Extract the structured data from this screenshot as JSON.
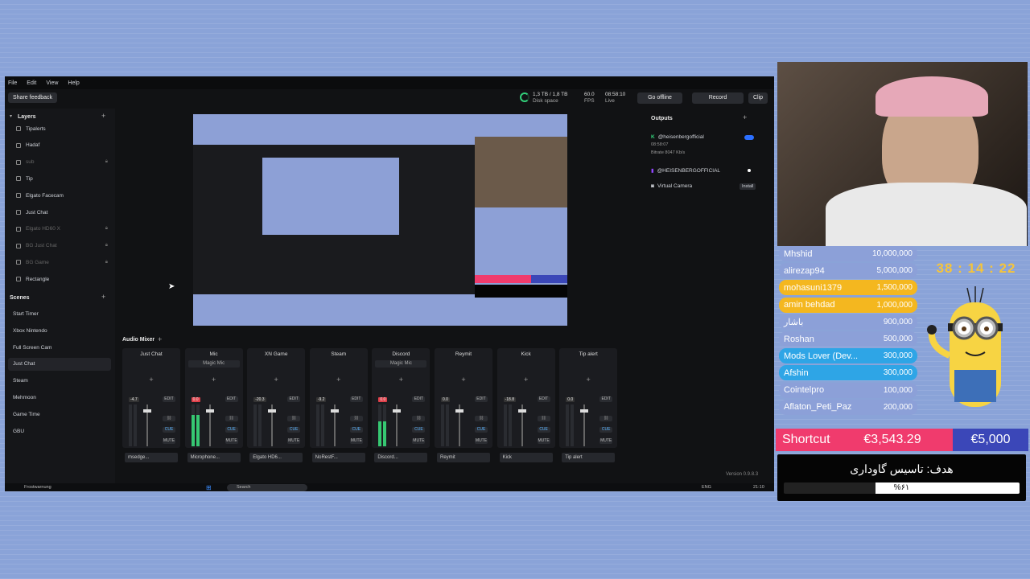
{
  "menu": [
    "File",
    "Edit",
    "View",
    "Help"
  ],
  "top": {
    "feedback": "Share feedback",
    "disk": "1,3 TB / 1,8 TB",
    "disk_label": "Disk space",
    "fps": "60.0",
    "fps_label": "FPS",
    "live_time": "08:58:10",
    "live_label": "Live",
    "go_offline": "Go offline",
    "record": "Record",
    "clip": "Clip"
  },
  "layers": {
    "title": "Layers",
    "items": [
      {
        "name": "Tipalerts",
        "dim": false
      },
      {
        "name": "Hadaf",
        "dim": false
      },
      {
        "name": "sub",
        "dim": true
      },
      {
        "name": "Tip",
        "dim": false
      },
      {
        "name": "Elgato Facecam",
        "dim": false
      },
      {
        "name": "Just Chat",
        "dim": false
      },
      {
        "name": "Elgato HD60 X",
        "dim": true
      },
      {
        "name": "BG Just Chat",
        "dim": true
      },
      {
        "name": "BG Game",
        "dim": true
      },
      {
        "name": "Rectangle",
        "dim": false
      }
    ]
  },
  "scenes": {
    "title": "Scenes",
    "items": [
      "Start Timer",
      "Xbox Nintendo",
      "Full Screen Cam",
      "Just Chat",
      "Steam",
      "Mehmoon",
      "Game Time",
      "GBU"
    ],
    "active": "Just Chat"
  },
  "outputs": {
    "title": "Outputs",
    "items": [
      {
        "name": "@heisenbergofficial",
        "sub": "08:58:07",
        "bitrate": "Bitrate 8047 Kb/s"
      },
      {
        "name": "@HEISENBERGOFFICIAL"
      },
      {
        "name": "Virtual Camera",
        "action": "Install"
      }
    ]
  },
  "mixer": {
    "title": "Audio Mixer",
    "edit": "EDIT",
    "cue": "CUE",
    "mute": "MUTE",
    "channels": [
      {
        "name": "Just Chat",
        "sub": "",
        "src": "msedge...",
        "level": 0.0,
        "vol": "-4.7"
      },
      {
        "name": "Mic",
        "sub": "Magic Mic",
        "src": "Microphone...",
        "level": 0.75,
        "vol": "0.0"
      },
      {
        "name": "XN Game",
        "sub": "",
        "src": "Elgato HD6...",
        "level": 0.0,
        "vol": "-20.3"
      },
      {
        "name": "Steam",
        "sub": "",
        "src": "NoRestF...",
        "level": 0.0,
        "vol": "-9.2"
      },
      {
        "name": "Discord",
        "sub": "Magic Mic",
        "src": "Discord...",
        "level": 0.6,
        "vol": "0.0"
      },
      {
        "name": "Reymit",
        "sub": "",
        "src": "Reymit",
        "level": 0.0,
        "vol": "0.0"
      },
      {
        "name": "Kick",
        "sub": "",
        "src": "Kick",
        "level": 0.0,
        "vol": "-18.8"
      },
      {
        "name": "Tip alert",
        "sub": "",
        "src": "Tip alert",
        "level": 0.0,
        "vol": "0.0"
      }
    ]
  },
  "version": "Version 0.9.8.3",
  "taskbar": {
    "weather": "Frostwarnung",
    "search": "Search",
    "lang": "ENG",
    "time": "21:10"
  },
  "donors": [
    {
      "name": "Mhshid",
      "amount": "10,000,000",
      "color": "#8ca0d8"
    },
    {
      "name": "alirezap94",
      "amount": "5,000,000",
      "color": "#8ca0d8"
    },
    {
      "name": "mohasuni1379",
      "amount": "1,500,000",
      "color": "#f4b71f"
    },
    {
      "name": "amin behdad",
      "amount": "1,000,000",
      "color": "#f4b71f"
    },
    {
      "name": "باشار",
      "amount": "900,000",
      "color": "#8ca0d8"
    },
    {
      "name": "Roshan",
      "amount": "500,000",
      "color": "#8ca0d8"
    },
    {
      "name": "Mods Lover (Dev...",
      "amount": "300,000",
      "color": "#2ea5e6"
    },
    {
      "name": "Afshin",
      "amount": "300,000",
      "color": "#2ea5e6"
    },
    {
      "name": "Cointelpro",
      "amount": "100,000",
      "color": "#8ca0d8"
    },
    {
      "name": "Aflaton_Peti_Paz",
      "amount": "200,000",
      "color": "#8ca0d8"
    }
  ],
  "timer": "38 : 14 : 22",
  "banner": {
    "label": "Shortcut",
    "raised": "€3,543.29",
    "goal": "€5,000"
  },
  "goal": {
    "title": "هدف: تاسیس گاوداری",
    "percent_label": "%۶۱",
    "progress": 0.61
  },
  "colors": {
    "accent_green": "#32d17a",
    "pink": "#f03b6d",
    "blue": "#3b47b8"
  }
}
